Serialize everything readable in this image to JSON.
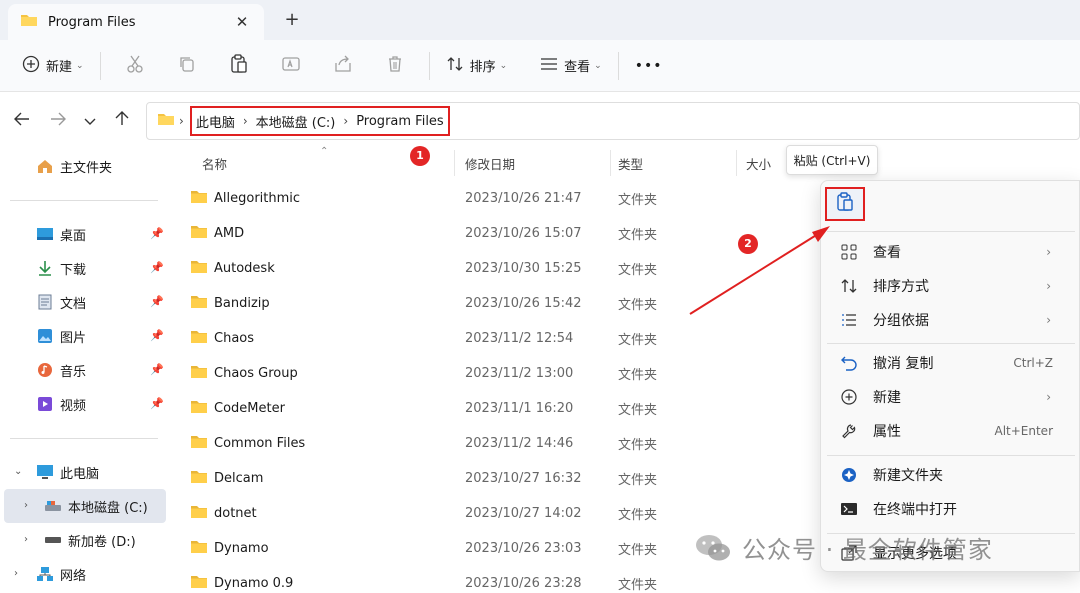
{
  "tab": {
    "title": "Program Files",
    "close": "✕",
    "new_tab": "+"
  },
  "toolbar": {
    "new_label": "新建",
    "sort_label": "排序",
    "view_label": "查看",
    "more": "•••"
  },
  "address": {
    "crumbs": [
      "此电脑",
      "本地磁盘 (C:)",
      "Program Files"
    ],
    "badge": "1"
  },
  "sidebar": {
    "home": "主文件夹",
    "quick": [
      "桌面",
      "下载",
      "文档",
      "图片",
      "音乐",
      "视频"
    ],
    "this_pc": "此电脑",
    "drive_c": "本地磁盘 (C:)",
    "drive_d": "新加卷 (D:)",
    "network": "网络"
  },
  "columns": {
    "name": "名称",
    "date": "修改日期",
    "type": "类型",
    "size": "大小"
  },
  "files": [
    {
      "name": "Allegorithmic",
      "date": "2023/10/26 21:47",
      "type": "文件夹"
    },
    {
      "name": "AMD",
      "date": "2023/10/26 15:07",
      "type": "文件夹"
    },
    {
      "name": "Autodesk",
      "date": "2023/10/30 15:25",
      "type": "文件夹"
    },
    {
      "name": "Bandizip",
      "date": "2023/10/26 15:42",
      "type": "文件夹"
    },
    {
      "name": "Chaos",
      "date": "2023/11/2 12:54",
      "type": "文件夹"
    },
    {
      "name": "Chaos Group",
      "date": "2023/11/2 13:00",
      "type": "文件夹"
    },
    {
      "name": "CodeMeter",
      "date": "2023/11/1 16:20",
      "type": "文件夹"
    },
    {
      "name": "Common Files",
      "date": "2023/11/2 14:46",
      "type": "文件夹"
    },
    {
      "name": "Delcam",
      "date": "2023/10/27 16:32",
      "type": "文件夹"
    },
    {
      "name": "dotnet",
      "date": "2023/10/27 14:02",
      "type": "文件夹"
    },
    {
      "name": "Dynamo",
      "date": "2023/10/26 23:03",
      "type": "文件夹"
    },
    {
      "name": "Dynamo 0.9",
      "date": "2023/10/26 23:28",
      "type": "文件夹"
    }
  ],
  "tooltip": "粘贴 (Ctrl+V)",
  "context_menu": {
    "badge": "2",
    "view": "查看",
    "sort": "排序方式",
    "group": "分组依据",
    "undo": "撤消 复制",
    "undo_shortcut": "Ctrl+Z",
    "new": "新建",
    "properties": "属性",
    "properties_shortcut": "Alt+Enter",
    "new_folder": "新建文件夹",
    "terminal": "在终端中打开",
    "more_options": "显示更多选项"
  },
  "watermark": "公众号 · 最全软件管家",
  "colors": {
    "accent_red": "#e02020",
    "folder": "#f5c342",
    "badge": "#e32626"
  }
}
